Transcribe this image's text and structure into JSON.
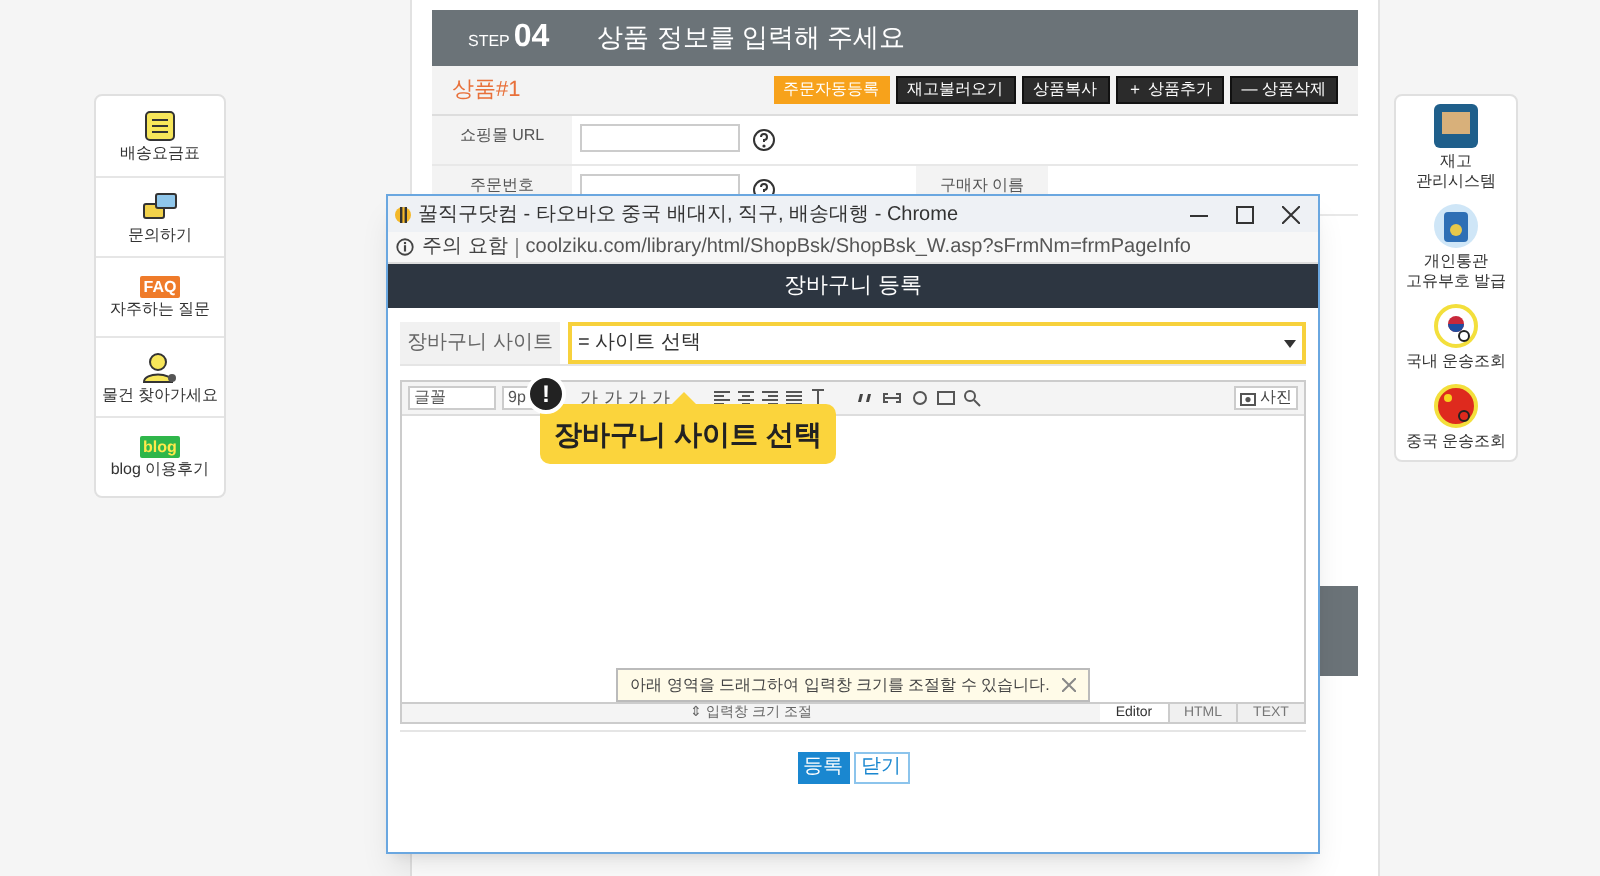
{
  "left_sidebar": [
    {
      "kind": "list",
      "label": "배송요금표"
    },
    {
      "kind": "chat",
      "label": "문의하기"
    },
    {
      "kind": "badge",
      "badge": "FAQ",
      "label": "자주하는 질문"
    },
    {
      "kind": "person",
      "label": "물건 찾아가세요"
    },
    {
      "kind": "blog",
      "badge": "blog",
      "label": "blog 이용후기"
    }
  ],
  "step": {
    "prefix": "STEP",
    "number": "04",
    "title": "상품 정보를 입력해 주세요"
  },
  "product": {
    "label": "상품#1",
    "buttons": [
      {
        "label": "주문자동등록",
        "kind": "primary"
      },
      {
        "label": "재고불러오기",
        "kind": "dark"
      },
      {
        "label": "상품복사",
        "kind": "dark"
      },
      {
        "label": "＋ 상품추가",
        "kind": "dark"
      },
      {
        "label": "— 상품삭제",
        "kind": "dark"
      }
    ]
  },
  "form_rows": [
    {
      "label": "쇼핑몰 URL"
    },
    {
      "label": "주문번호",
      "label_2": "구매자 이름"
    }
  ],
  "right_sidebar": [
    {
      "kind": "box",
      "label": "재고\n관리시스템"
    },
    {
      "kind": "passport",
      "label": "개인통관\n고유부호 발급"
    },
    {
      "kind": "kr",
      "label": "국내 운송조회"
    },
    {
      "kind": "cn",
      "label": "중국 운송조회"
    }
  ],
  "popup": {
    "title": "꿀직구닷컴 - 타오바오 중국 배대지, 직구, 배송대행 - Chrome",
    "security": "주의 요함",
    "url": "coolziku.com/library/html/ShopBsk/ShopBsk_W.asp?sFrmNm=frmPageInfo",
    "header": "장바구니 등록",
    "site_label": "장바구니 사이트",
    "site_select": "= 사이트 선택",
    "font_select": "글꼴",
    "size_select": "9p",
    "toolbar": [
      "가",
      "가",
      "가",
      "가"
    ],
    "photo_button": "사진",
    "hint": "아래 영역을 드래그하여 입력창 크기를 조절할 수 있습니다.",
    "resize_label": "⇕ 입력창 크기 조절",
    "tabs": [
      {
        "label": "Editor",
        "selected": true
      },
      {
        "label": "HTML",
        "selected": false
      },
      {
        "label": "TEXT",
        "selected": false
      }
    ],
    "buttons": [
      {
        "label": "등록",
        "kind": "primary"
      },
      {
        "label": "닫기",
        "kind": "secondary"
      }
    ]
  },
  "callout": {
    "mark": "!",
    "text": "장바구니 사이트 선택"
  }
}
